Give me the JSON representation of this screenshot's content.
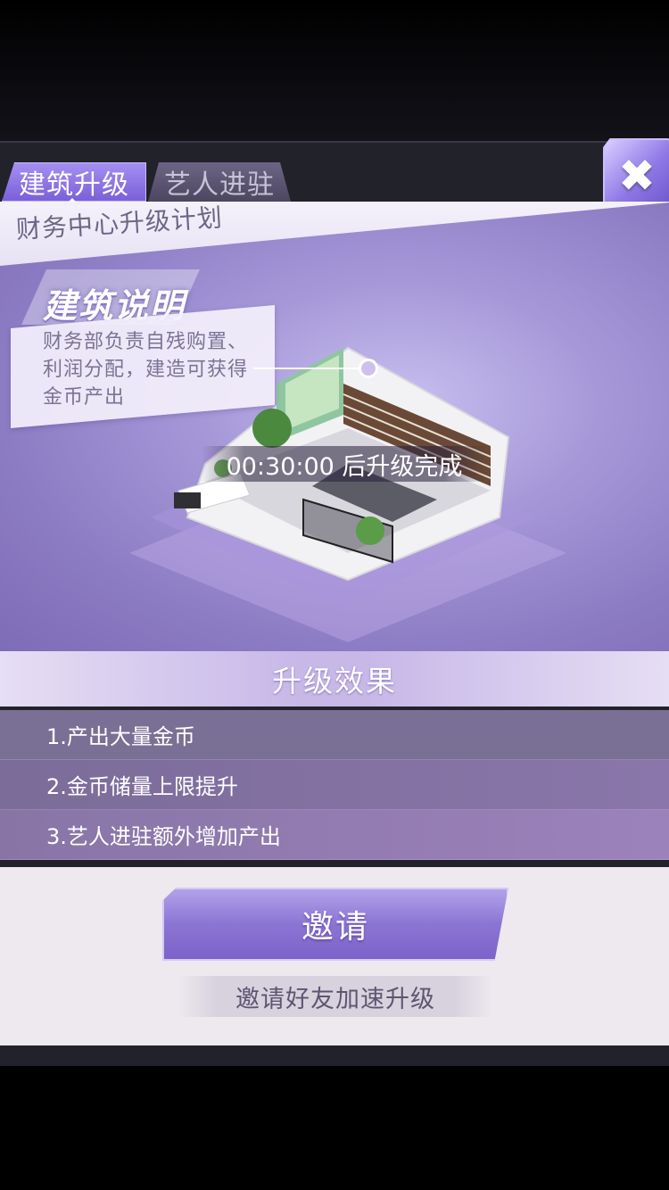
{
  "tabs": [
    {
      "label": "建筑升级",
      "active": true
    },
    {
      "label": "艺人进驻",
      "active": false
    }
  ],
  "close_icon": "close-x-icon",
  "plan_title": "财务中心升级计划",
  "description": {
    "heading": "建筑说明",
    "text": "财务部负责自残购置、利润分配，建造可获得金币产出"
  },
  "timer": "00:30:00 后升级完成",
  "effect": {
    "header": "升级效果",
    "items": [
      "1.产出大量金币",
      "2.金币储量上限提升",
      "3.艺人进驻额外增加产出"
    ]
  },
  "invite_button": "邀请",
  "accelerate_text": "邀请好友加速升级",
  "colors": {
    "accent_purple": "#8b75d4",
    "tab_active": "#a590f2",
    "list_bg": "#7a6f94"
  }
}
